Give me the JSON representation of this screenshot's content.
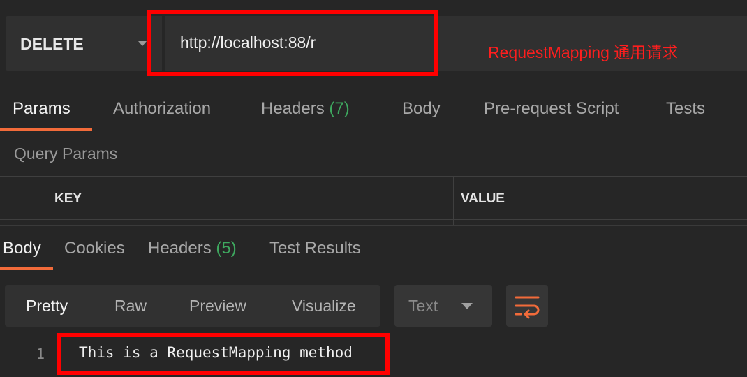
{
  "request": {
    "method": "DELETE",
    "url": "http://localhost:88/r"
  },
  "annotation": "RequestMapping 通用请求",
  "request_tabs": [
    {
      "label": "Params",
      "count": ""
    },
    {
      "label": "Authorization",
      "count": ""
    },
    {
      "label": "Headers",
      "count": "(7)"
    },
    {
      "label": "Body",
      "count": ""
    },
    {
      "label": "Pre-request Script",
      "count": ""
    },
    {
      "label": "Tests",
      "count": ""
    }
  ],
  "query_params": {
    "title": "Query Params",
    "columns": [
      "KEY",
      "VALUE"
    ]
  },
  "response_tabs": [
    {
      "label": "Body",
      "count": ""
    },
    {
      "label": "Cookies",
      "count": ""
    },
    {
      "label": "Headers",
      "count": "(5)"
    },
    {
      "label": "Test Results",
      "count": ""
    }
  ],
  "view_modes": [
    "Pretty",
    "Raw",
    "Preview",
    "Visualize"
  ],
  "response_type": "Text",
  "response_body": {
    "line_number": "1",
    "text": "This is a RequestMapping method"
  },
  "colors": {
    "accent": "#f26b3a",
    "count_green": "#3ea85f",
    "highlight_red": "#ff0000"
  }
}
